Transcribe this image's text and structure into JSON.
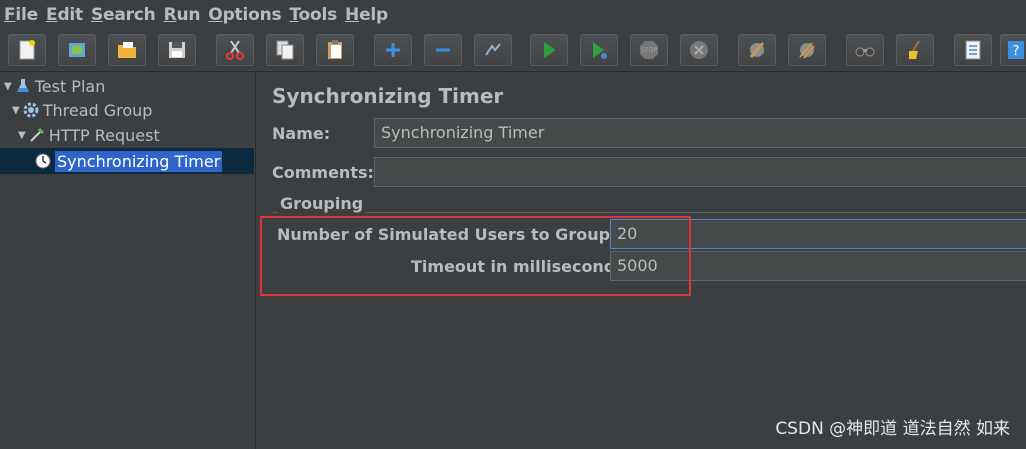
{
  "menu": [
    {
      "mn": "F",
      "rest": "ile"
    },
    {
      "mn": "E",
      "rest": "dit"
    },
    {
      "mn": "S",
      "rest": "earch"
    },
    {
      "mn": "R",
      "rest": "un"
    },
    {
      "mn": "O",
      "rest": "ptions"
    },
    {
      "mn": "T",
      "rest": "ools"
    },
    {
      "mn": "H",
      "rest": "elp"
    }
  ],
  "toolbar": [
    "new-icon",
    "templates-icon",
    "open-icon",
    "save-icon",
    "cut-icon",
    "copy-icon",
    "paste-icon",
    "expand-icon",
    "collapse-icon",
    "toggle-icon",
    "start-icon",
    "start-no-pauses-icon",
    "stop-icon",
    "shutdown-icon",
    "clear-icon",
    "clear-all-icon",
    "search-icon",
    "reset-search-icon",
    "function-helper-icon",
    "help-icon"
  ],
  "tree": {
    "items": [
      {
        "label": "Test Plan",
        "icon": "flask-icon"
      },
      {
        "label": "Thread Group",
        "icon": "gear-icon"
      },
      {
        "label": "HTTP Request",
        "icon": "pipette-icon"
      },
      {
        "label": "Synchronizing Timer",
        "icon": "stopwatch-icon",
        "selected": true
      }
    ]
  },
  "panel": {
    "title": "Synchronizing Timer",
    "name_label": "Name:",
    "name_value": "Synchronizing Timer",
    "comments_label": "Comments:",
    "comments_value": "",
    "group_title": "Grouping",
    "users_label": "Number of Simulated Users to Group by:",
    "users_value": "20",
    "timeout_label": "Timeout in milliseconds:",
    "timeout_value": "5000"
  },
  "watermark": "CSDN @神即道 道法自然 如来",
  "colors": {
    "highlight": "#e0343c",
    "selection": "#2f65ca",
    "background": "#3c3f41"
  }
}
